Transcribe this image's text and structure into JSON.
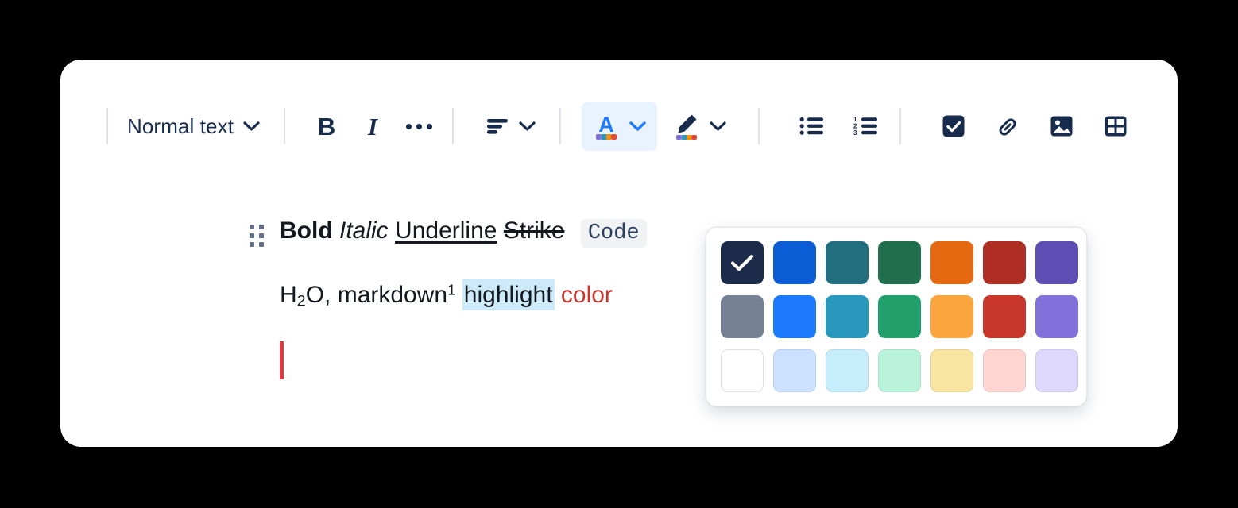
{
  "app": {
    "background_color": "#000000",
    "card_color": "#ffffff"
  },
  "toolbar": {
    "text_style_label": "Normal text",
    "bold_label": "B",
    "italic_label": "I",
    "more_formatting_label": "•••",
    "align_label": "Text alignment",
    "text_color_label": "A",
    "highlight_label": "Highlight color",
    "bullet_list_label": "Bulleted list",
    "numbered_list_label": "Numbered list",
    "task_list_label": "Action item",
    "link_label": "Link",
    "image_label": "Image",
    "table_label": "Table",
    "icon_color": "#172b4d",
    "active_bg": "#e9f2ff",
    "active_fg": "#1d7afc",
    "separator_color": "#dfe3ea"
  },
  "document": {
    "line1": {
      "bold": "Bold",
      "italic": "Italic",
      "underline": "Underline",
      "strike": "Strike",
      "code": "Code"
    },
    "line2": {
      "formula_base": "H",
      "formula_sub": "2",
      "formula_tail": "O, ",
      "markdown": "markdown",
      "markdown_sup": "1",
      "highlight": "highlight",
      "color_word": "color",
      "highlight_bg": "#cdeafb",
      "color_word_color": "#c9372c"
    },
    "caret_color": "#e03a3f"
  },
  "palette": {
    "selected_index": 0,
    "colors": [
      {
        "name": "dark-navy",
        "hex": "#1d2b4a"
      },
      {
        "name": "blue",
        "hex": "#0b5cd5"
      },
      {
        "name": "teal",
        "hex": "#216e7f"
      },
      {
        "name": "green",
        "hex": "#216e4e"
      },
      {
        "name": "orange",
        "hex": "#e56910"
      },
      {
        "name": "dark-red",
        "hex": "#ae2e24"
      },
      {
        "name": "purple",
        "hex": "#5e4db2"
      },
      {
        "name": "gray",
        "hex": "#758195"
      },
      {
        "name": "bright-blue",
        "hex": "#1d7afc"
      },
      {
        "name": "cyan",
        "hex": "#2898bd"
      },
      {
        "name": "mid-green",
        "hex": "#22a06b"
      },
      {
        "name": "light-orange",
        "hex": "#faa53d"
      },
      {
        "name": "red",
        "hex": "#c9372c"
      },
      {
        "name": "light-purple",
        "hex": "#8270db"
      },
      {
        "name": "white",
        "hex": "#ffffff"
      },
      {
        "name": "pale-blue",
        "hex": "#cce0ff"
      },
      {
        "name": "pale-cyan",
        "hex": "#c6edfb"
      },
      {
        "name": "pale-green",
        "hex": "#baf3db"
      },
      {
        "name": "pale-yellow",
        "hex": "#f8e6a0"
      },
      {
        "name": "pale-red",
        "hex": "#ffd5d2"
      },
      {
        "name": "pale-purple",
        "hex": "#dfd8fd"
      }
    ]
  }
}
